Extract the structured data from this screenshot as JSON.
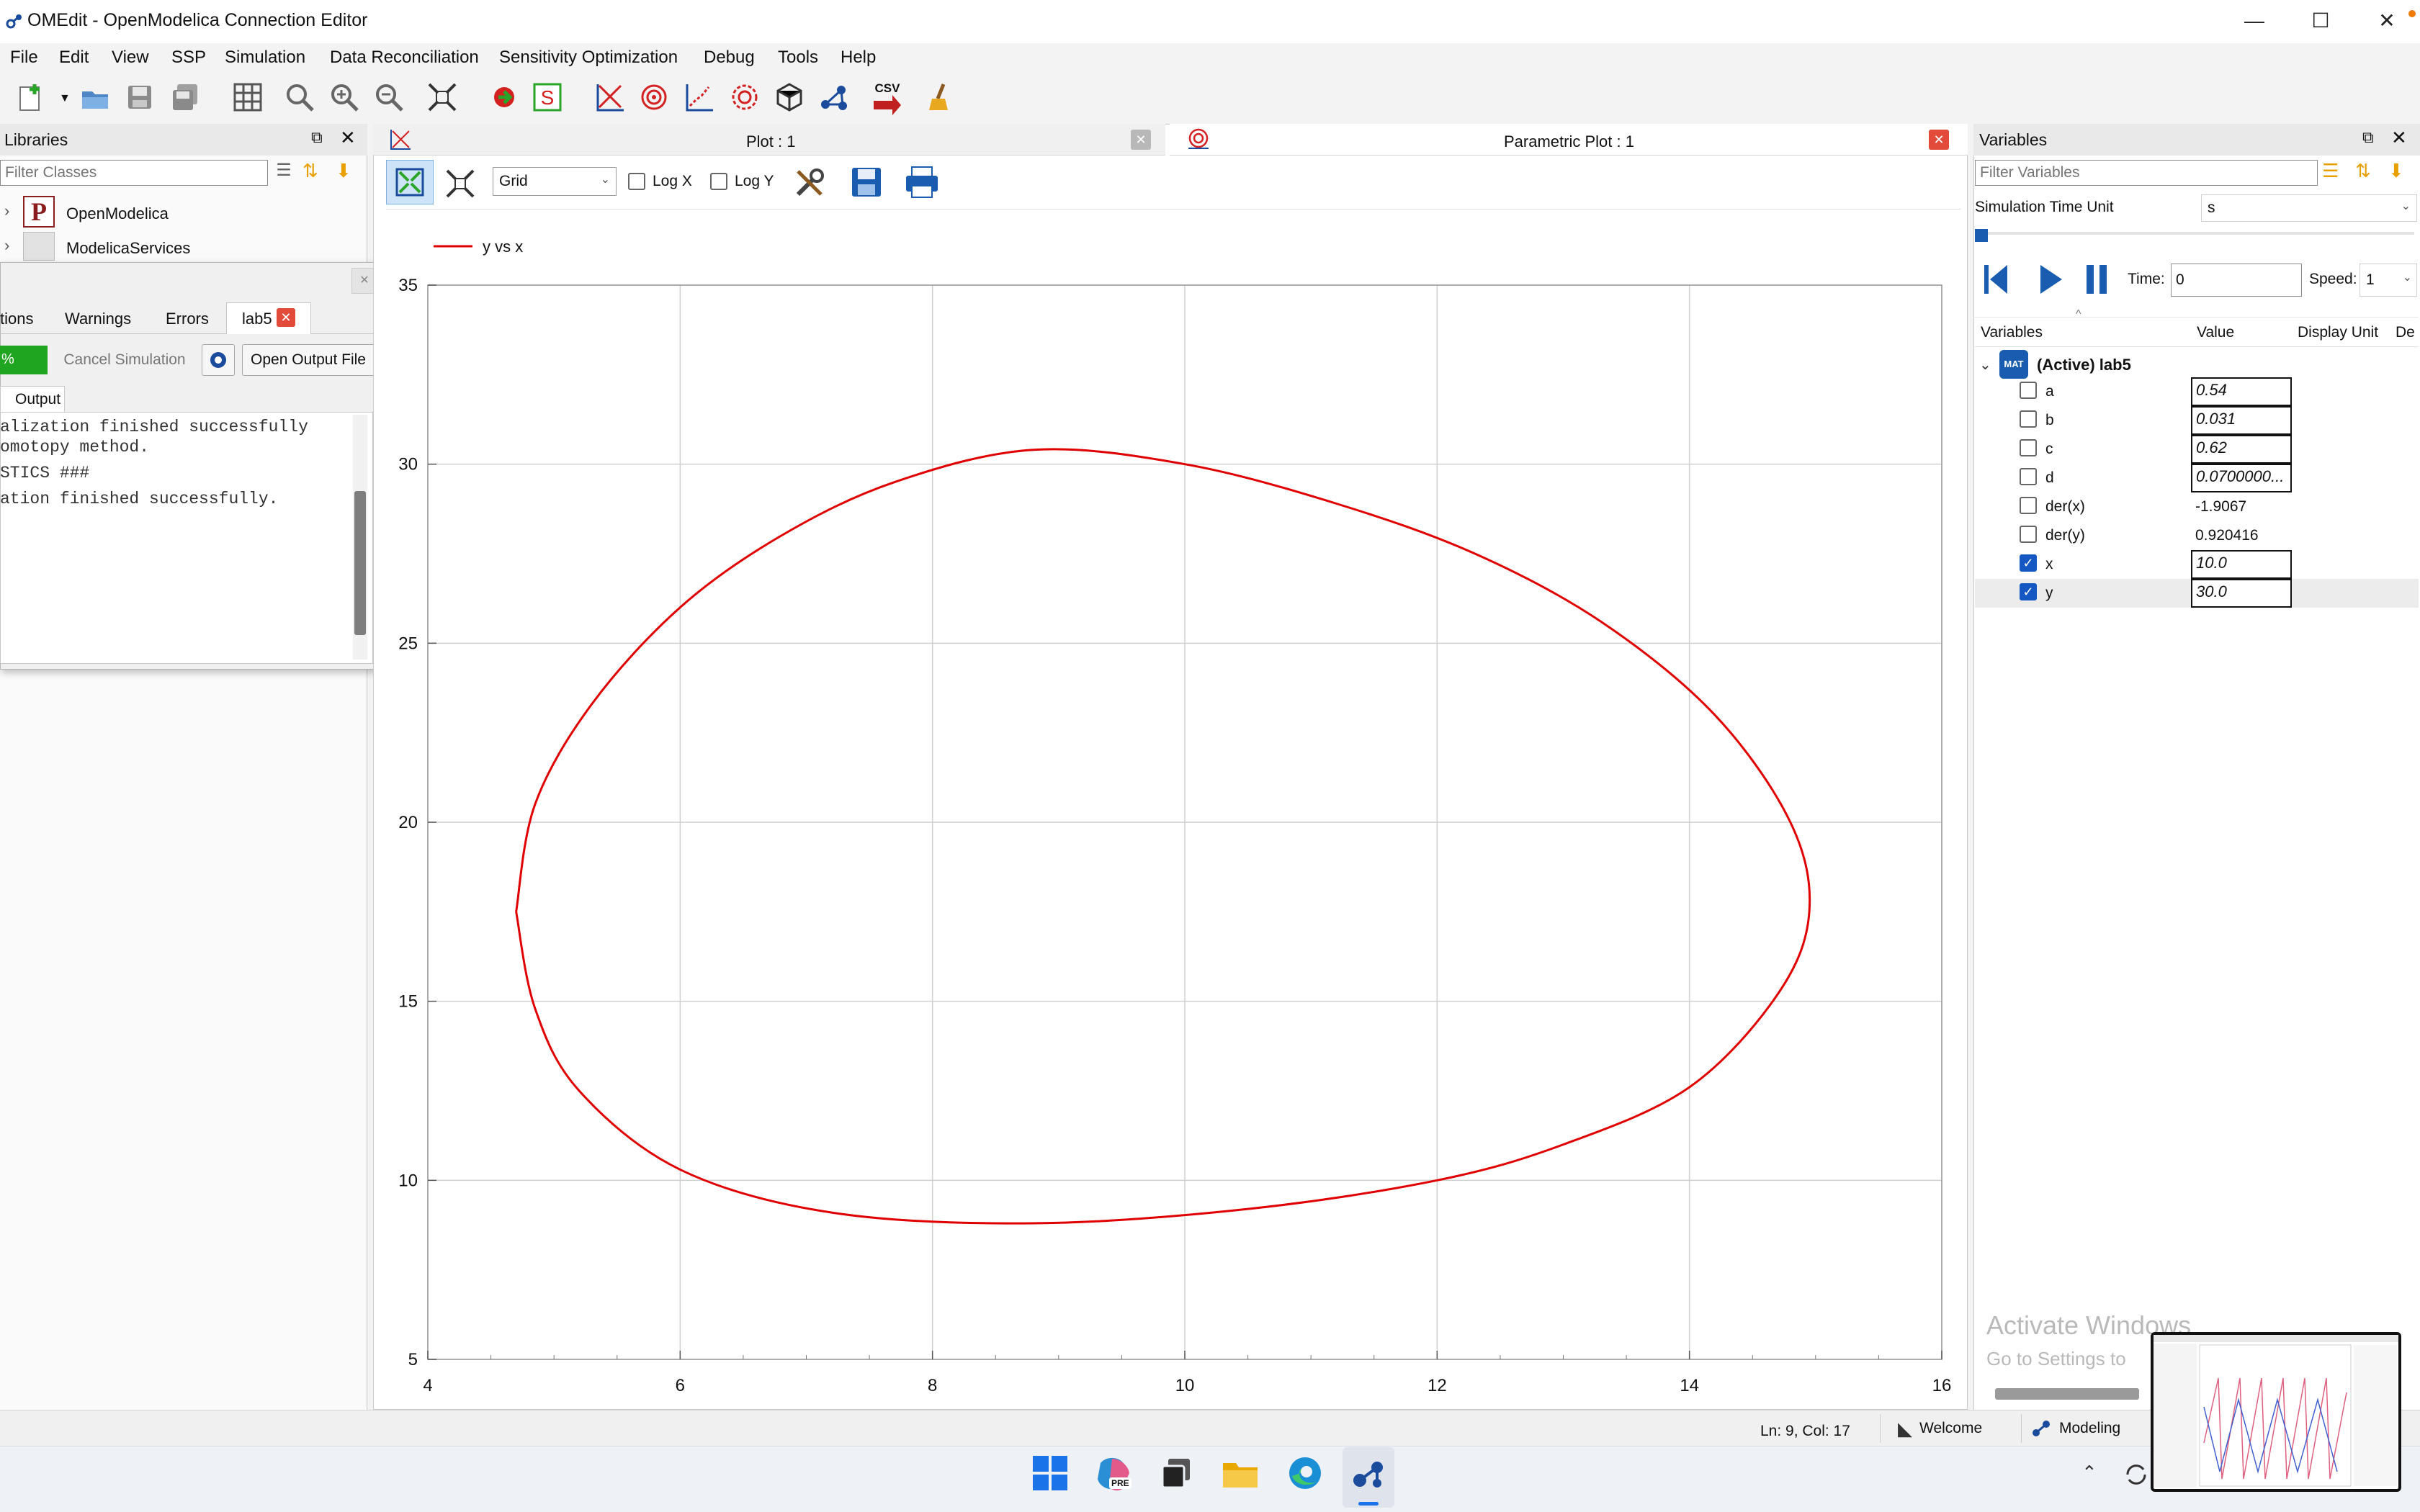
{
  "window": {
    "title": "OMEdit - OpenModelica Connection Editor",
    "min": "—",
    "max": "☐",
    "close": "✕"
  },
  "menu": [
    "File",
    "Edit",
    "View",
    "SSP",
    "Simulation",
    "Data Reconciliation",
    "Sensitivity Optimization",
    "Debug",
    "Tools",
    "Help"
  ],
  "toolbar": {
    "csv_label": "CSV"
  },
  "libraries": {
    "title": "Libraries",
    "filter_placeholder": "Filter Classes",
    "items": [
      {
        "label": "OpenModelica"
      },
      {
        "label": "ModelicaServices"
      }
    ]
  },
  "sim_output": {
    "tabs": [
      "tions",
      "Warnings",
      "Errors",
      "lab5"
    ],
    "progress_label": "%",
    "cancel_label": "Cancel Simulation",
    "open_output_label": "Open Output File",
    "output_tab": "Output",
    "lines": [
      "alization finished successfully",
      "omotopy method.",
      "STICS ###",
      "ation finished successfully."
    ]
  },
  "plot_tabs": {
    "plot": "Plot : 1",
    "parametric": "Parametric Plot : 1"
  },
  "plot_toolbar": {
    "grid_value": "Grid",
    "logx": "Log X",
    "logy": "Log Y"
  },
  "chart_data": {
    "type": "line",
    "legend": [
      {
        "name": "y vs x",
        "color": "#e00000"
      }
    ],
    "xlim": [
      4,
      16
    ],
    "ylim": [
      5,
      35
    ],
    "x_ticks": [
      "4",
      "6",
      "8",
      "10",
      "12",
      "14",
      "16"
    ],
    "y_ticks": [
      "5",
      "10",
      "15",
      "20",
      "25",
      "30",
      "35"
    ],
    "grid": true,
    "series": [
      {
        "name": "y vs x",
        "color": "#e00000",
        "points": [
          [
            4.7,
            17.5
          ],
          [
            4.85,
            20.5
          ],
          [
            5.3,
            23.3
          ],
          [
            6.0,
            26.0
          ],
          [
            6.8,
            28.0
          ],
          [
            7.7,
            29.5
          ],
          [
            8.8,
            30.4
          ],
          [
            10.0,
            30.0
          ],
          [
            11.2,
            28.9
          ],
          [
            12.3,
            27.5
          ],
          [
            13.3,
            25.6
          ],
          [
            14.2,
            23.0
          ],
          [
            14.8,
            20.0
          ],
          [
            14.95,
            17.5
          ],
          [
            14.7,
            15.2
          ],
          [
            14.0,
            12.6
          ],
          [
            13.0,
            11.0
          ],
          [
            12.0,
            10.0
          ],
          [
            10.5,
            9.2
          ],
          [
            8.8,
            8.8
          ],
          [
            7.2,
            9.1
          ],
          [
            6.0,
            10.3
          ],
          [
            5.2,
            12.5
          ],
          [
            4.85,
            14.8
          ],
          [
            4.7,
            17.5
          ]
        ]
      }
    ]
  },
  "variables": {
    "title": "Variables",
    "filter_placeholder": "Filter Variables",
    "time_unit_label": "Simulation Time Unit",
    "time_unit_value": "s",
    "time_label": "Time:",
    "time_value": "0",
    "speed_label": "Speed:",
    "speed_value": "1",
    "columns": [
      "Variables",
      "Value",
      "Display Unit",
      "De"
    ],
    "model": "(Active) lab5",
    "rows": [
      {
        "name": "a",
        "value": "0.54",
        "checked": false,
        "editable": true
      },
      {
        "name": "b",
        "value": "0.031",
        "checked": false,
        "editable": true
      },
      {
        "name": "c",
        "value": "0.62",
        "checked": false,
        "editable": true
      },
      {
        "name": "d",
        "value": "0.0700000...",
        "checked": false,
        "editable": true
      },
      {
        "name": "der(x)",
        "value": "-1.9067",
        "checked": false,
        "editable": false
      },
      {
        "name": "der(y)",
        "value": "0.920416",
        "checked": false,
        "editable": false
      },
      {
        "name": "x",
        "value": "10.0",
        "checked": true,
        "editable": true
      },
      {
        "name": "y",
        "value": "30.0",
        "checked": true,
        "editable": true
      }
    ]
  },
  "watermark": {
    "line1": "Activate Windows",
    "line2": "Go to Settings to"
  },
  "statusbar": {
    "position": "Ln: 9, Col: 17",
    "welcome": "Welcome",
    "modeling": "Modeling"
  },
  "taskbar": {
    "copilot_badge": "PRE"
  }
}
